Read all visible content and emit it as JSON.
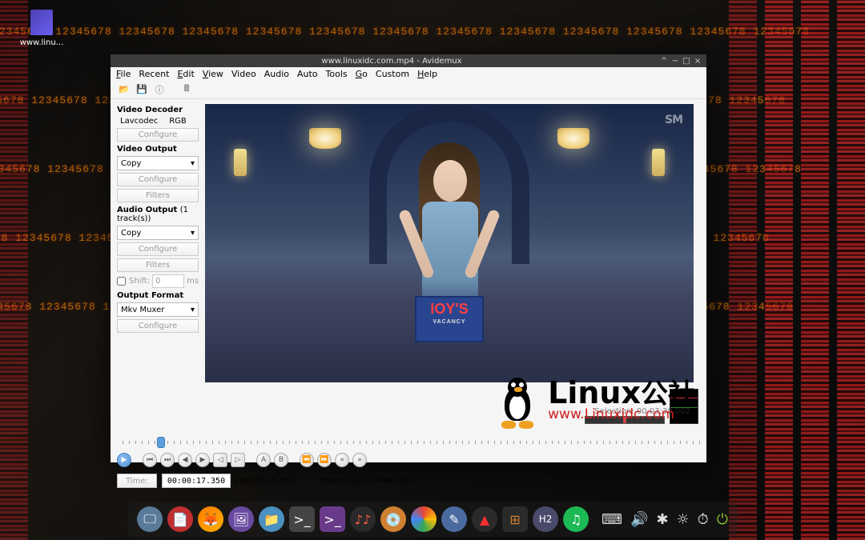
{
  "desktop": {
    "icon_label": "www.linu..."
  },
  "window": {
    "title": "www.linuxidc.com.mp4 - Avidemux"
  },
  "menubar": {
    "items": [
      "File",
      "Recent",
      "Edit",
      "View",
      "Video",
      "Audio",
      "Auto",
      "Tools",
      "Go",
      "Custom",
      "Help"
    ]
  },
  "sidebar": {
    "decoder": {
      "head": "Video Decoder",
      "val1": "Lavcodec",
      "val2": "RGB",
      "configure": "Configure"
    },
    "video_out": {
      "head": "Video Output",
      "combo": "Copy",
      "configure": "Configure",
      "filters": "Filters"
    },
    "audio_out": {
      "head": "Audio Output",
      "tracks": "(1 track(s))",
      "combo": "Copy",
      "configure": "Configure",
      "filters": "Filters",
      "shift": "Shift:",
      "shift_val": "0",
      "ms": "ms"
    },
    "format": {
      "head": "Output Format",
      "combo": "Mkv Muxer",
      "configure": "Configure"
    }
  },
  "video": {
    "sign_main": "IOY'S",
    "sign_sub": "VACANCY",
    "sm": "SM"
  },
  "time": {
    "time_btn": "Time:",
    "current": "00:00:17.350",
    "total": "/ 00:03:30.002",
    "frame_type": "Frame type:  I-FRM (00)",
    "selection": "Selection: 00:03:30.002"
  },
  "watermark": {
    "main": "Linux",
    "cn": "公社",
    "url": "www.Linuxidc.com"
  },
  "dock": {
    "items": [
      "sys",
      "pdf",
      "firefox",
      "photos",
      "files",
      "term1",
      "term2",
      "mixer",
      "disk",
      "chrome",
      "arrow",
      "peak",
      "grid",
      "h2",
      "spotify"
    ]
  },
  "numbers": "12345678  12345678  12345678  12345678  12345678  12345678  12345678  12345678  12345678  12345678  12345678  12345678  12345678"
}
